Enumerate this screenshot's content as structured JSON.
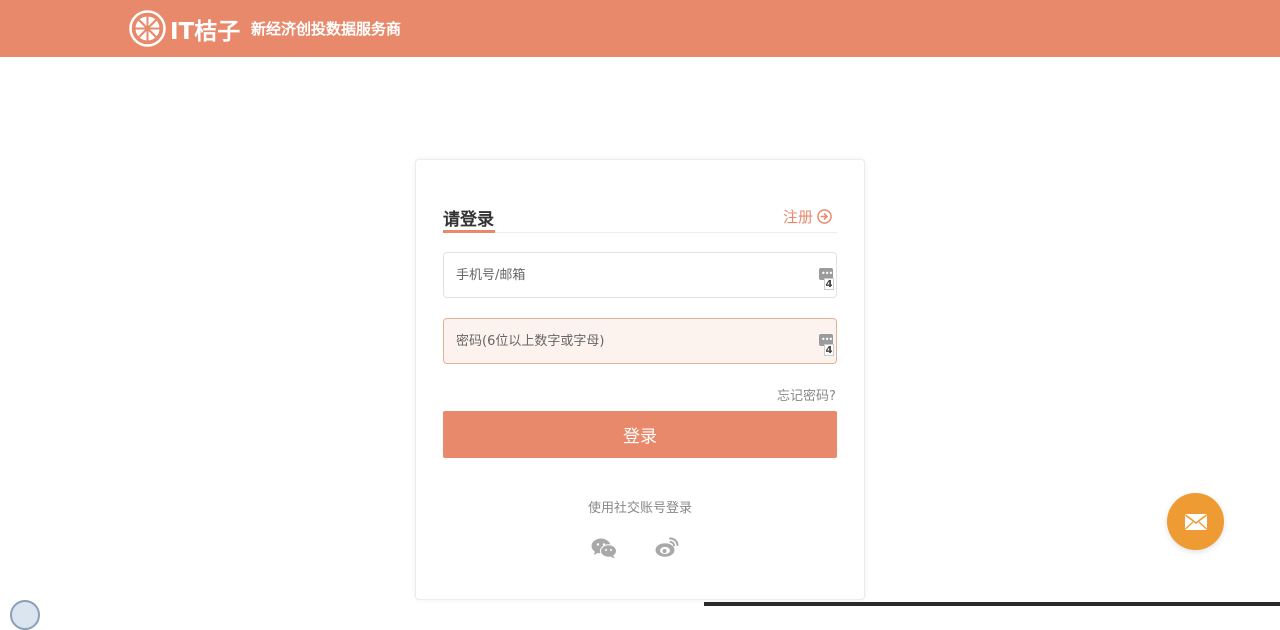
{
  "header": {
    "brand": "IT桔子",
    "slogan": "新经济创投数据服务商",
    "color": "#e8896b"
  },
  "login": {
    "title": "请登录",
    "register_label": "注册",
    "phone_placeholder": "手机号/邮箱",
    "password_placeholder": "密码(6位以上数字或字母)",
    "password_manager_badge": "4",
    "forgot_label": "忘记密码?",
    "submit_label": "登录",
    "social_label": "使用社交账号登录",
    "social_icons": [
      "wechat-icon",
      "weibo-icon"
    ]
  },
  "fab": {
    "icon": "mail-icon",
    "color": "#ed9b32"
  }
}
